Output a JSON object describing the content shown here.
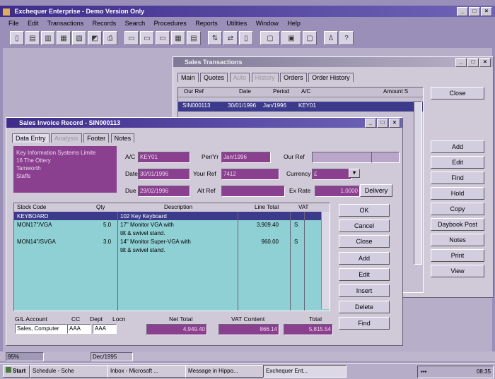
{
  "app": {
    "title": "Exchequer Enterprise - Demo Version Only",
    "menu": [
      "File",
      "Edit",
      "Transactions",
      "Records",
      "Search",
      "Procedures",
      "Reports",
      "Utilities",
      "Window",
      "Help"
    ]
  },
  "back_window": {
    "title": "Sales Transactions",
    "tabs": [
      "Main",
      "Quotes",
      "Auto",
      "History",
      "Orders",
      "Order History"
    ],
    "columns": [
      "Our Ref",
      "Date",
      "Period",
      "A/C",
      "Amount S"
    ],
    "row": [
      "SIN000113",
      "30/01/1996",
      "Jan/1996",
      "KEY01",
      ""
    ],
    "buttons": [
      "Close",
      "Add",
      "Edit",
      "Find",
      "Hold",
      "Copy",
      "Daybook Post",
      "Notes",
      "Print",
      "View"
    ]
  },
  "invoice": {
    "title": "Sales Invoice Record - SIN000113",
    "tabs": [
      "Data Entry",
      "Analysis",
      "Footer",
      "Notes"
    ],
    "address": [
      "Key Information Systems Limite",
      "16 The Ottery",
      "Tamworth",
      "Staffs"
    ],
    "ac_label": "A/C",
    "ac_value": "KEY01",
    "perYr_label": "Per/Yr",
    "perYr_value": "Jan/1996",
    "ourRef_label": "Our Ref",
    "date_label": "Date",
    "date_value": "30/01/1996",
    "yourRef_label": "Your Ref",
    "yourRef_value": "7412",
    "currency_label": "Currency",
    "currency_value": "£",
    "due_label": "Due",
    "due_value": "29/02/1996",
    "altRef_label": "Alt Ref",
    "exRate_label": "Ex Rate",
    "exRate_value": "1.0000",
    "delivery_label": "Delivery",
    "columns": [
      "Stock Code",
      "Qty",
      "Description",
      "Line Total",
      "VAT"
    ],
    "lines": [
      {
        "code": "KEYBOARD",
        "qty": "",
        "desc": "102 Key Keyboard",
        "total": "",
        "vat": ""
      },
      {
        "code": "MON17\"/VGA",
        "qty": "5.0",
        "desc": "17\" Monitor VGA with",
        "total": "3,909.40",
        "vat": "S"
      },
      {
        "code": "",
        "qty": "",
        "desc": "tilt & swivel stand.",
        "total": "",
        "vat": ""
      },
      {
        "code": "MON14\"/SVGA",
        "qty": "3.0",
        "desc": "14\" Monitor Super-VGA with",
        "total": "960.00",
        "vat": "S"
      },
      {
        "code": "",
        "qty": "",
        "desc": "tilt & swivel stand.",
        "total": "",
        "vat": ""
      }
    ],
    "side_buttons": [
      "OK",
      "Cancel",
      "Close",
      "Add",
      "Edit",
      "Insert",
      "Delete",
      "Find"
    ],
    "footer_labels": {
      "gl": "G/L Account",
      "cc": "CC",
      "dept": "Dept",
      "locn": "Locn",
      "netTotal": "Net Total",
      "vatContent": "VAT Content",
      "total": "Total"
    },
    "footer_values": {
      "gl": "Sales, Computer",
      "cc": "AAA",
      "dept": "AAA",
      "netTotal": "4,949.40",
      "vatContent": "866.14",
      "total": "5,815.54"
    }
  },
  "statusbar": {
    "zoom": "95%",
    "period": "Dec/1995"
  },
  "taskbar": {
    "start": "Start",
    "tasks": [
      "Schedule - Sche",
      "Inbox - Microsoft ...",
      "Message in Hippo...",
      "Exchequer Ent..."
    ],
    "clock": "08:35"
  }
}
